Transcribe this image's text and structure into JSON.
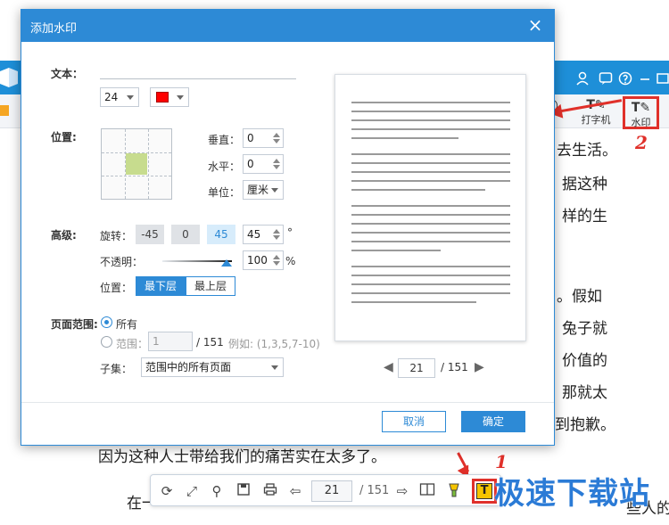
{
  "dialog": {
    "title": "添加水印",
    "close_glyph": "×",
    "text_label": "文本：",
    "font_size": "24",
    "position_label": "位置:",
    "vertical_label": "垂直：",
    "vertical_value": "0",
    "horizontal_label": "水平：",
    "horizontal_value": "0",
    "unit_label": "单位：",
    "unit_value": "厘米",
    "advanced_label": "高级:",
    "rotate_label": "旋转：",
    "rotate_options": [
      "-45",
      "0",
      "45"
    ],
    "rotate_value": "45",
    "degree_symbol": "°",
    "opacity_label": "不透明：",
    "opacity_value": "100",
    "percent_symbol": "%",
    "layer_label": "位置：",
    "layer_bottom": "最下层",
    "layer_top": "最上层",
    "page_range_label": "页面范围:",
    "all_pages": "所有",
    "range_label": "范围：",
    "range_value": "1",
    "range_total": "/ 151",
    "range_example": "例如: (1,3,5,7-10)",
    "subset_label": "子集：",
    "subset_value": "范围中的所有页面",
    "preview_page": "21",
    "preview_total": "/ 151",
    "cancel": "取消",
    "ok": "确定"
  },
  "app": {
    "toolbar_tool_label": "打字机",
    "watermark_label": "水印",
    "page_value": "21",
    "page_total": "/ 151"
  },
  "annotations": {
    "label_1": "1",
    "label_2": "2"
  },
  "document": {
    "lines": [
      "去生活。",
      "据这种",
      "样的生",
      "。假如",
      "兔子就",
      "价值的",
      "那就太",
      "到抱歉。",
      "因为这种人士带给我们的痛苦实在太多了。",
      "在一",
      "些人的"
    ]
  },
  "brand": {
    "text": "极速下载站"
  },
  "colors": {
    "accent": "#2d8ad6",
    "annotation_red": "#e0302a",
    "watermark_color": "#ff0000"
  }
}
